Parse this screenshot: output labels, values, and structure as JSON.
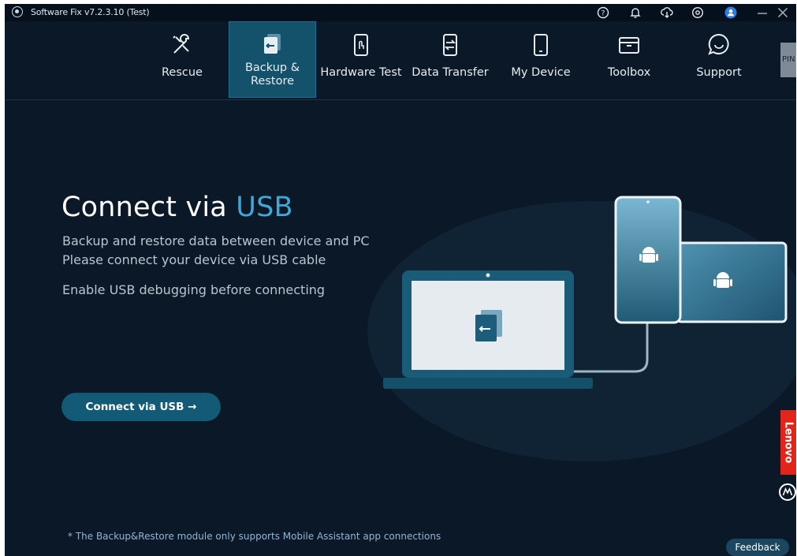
{
  "window": {
    "title": "Software Fix v7.2.3.10 (Test)"
  },
  "titlebar_icons": [
    "help-icon",
    "notification-bell-icon",
    "cloud-download-icon",
    "settings-icon",
    "user-avatar-icon",
    "minimize-icon",
    "close-icon"
  ],
  "nav": {
    "items": [
      {
        "label": "Rescue",
        "icon": "wrench-screwdriver-icon"
      },
      {
        "label": "Backup &\nRestore",
        "icon": "backup-restore-icon"
      },
      {
        "label": "Hardware Test",
        "icon": "touch-phone-icon"
      },
      {
        "label": "Data Transfer",
        "icon": "data-transfer-icon"
      },
      {
        "label": "My Device",
        "icon": "phone-icon"
      },
      {
        "label": "Toolbox",
        "icon": "toolbox-icon"
      },
      {
        "label": "Support",
        "icon": "chat-bubble-icon"
      }
    ],
    "active_index": 1,
    "pin_label": "PIN"
  },
  "hero": {
    "title_prefix": "Connect via",
    "title_accent": "USB",
    "line1": "Backup and restore data between device and PC",
    "line2": "Please connect your device via USB cable",
    "line3": "Enable USB debugging before connecting"
  },
  "cta": {
    "label": "Connect via USB  →"
  },
  "footnote": "* The Backup&Restore module only supports Mobile Assistant app connections",
  "feedback": {
    "label": "Feedback"
  },
  "brand": {
    "lenovo": "Lenovo",
    "lenovo_color": "#e1251b",
    "accent": "#3fa8d8"
  }
}
